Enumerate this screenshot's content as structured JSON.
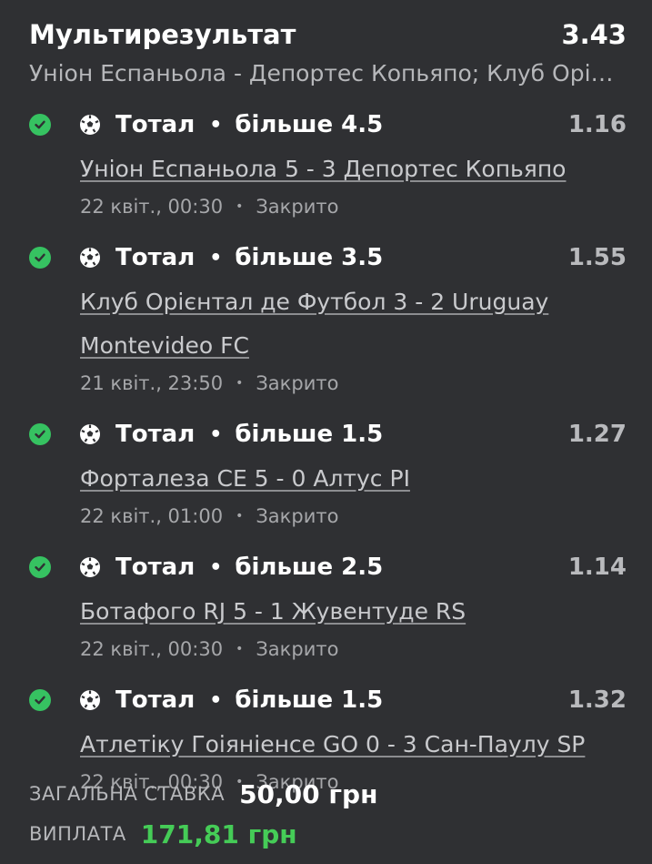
{
  "header": {
    "title": "Мультирезультат",
    "total_odds": "3.43",
    "subtitle": "Уніон Еспаньола - Депортес Копьяпо; Клуб Орієнтал де Футбол - Uruguay Montevideo FC; Форталеза CE - Алтус PI; Ботафого RJ - Жувентуде RS; Атлетіку Гоіяніенсе GO - Сан-Паулу SP"
  },
  "bets": [
    {
      "status_icon": "check-circle-icon",
      "sport_icon": "soccer-ball-icon",
      "market": "Тотал",
      "outcome": "більше 4.5",
      "odds": "1.16",
      "match": "Уніон Еспаньола 5 - 3 Депортес Копьяпо",
      "datetime": "22 квіт., 00:30",
      "state": "Закрито"
    },
    {
      "status_icon": "check-circle-icon",
      "sport_icon": "soccer-ball-icon",
      "market": "Тотал",
      "outcome": "більше 3.5",
      "odds": "1.55",
      "match": "Клуб Орієнтал де Футбол 3 - 2 Uruguay Montevideo FC",
      "datetime": "21 квіт., 23:50",
      "state": "Закрито"
    },
    {
      "status_icon": "check-circle-icon",
      "sport_icon": "soccer-ball-icon",
      "market": "Тотал",
      "outcome": "більше 1.5",
      "odds": "1.27",
      "match": "Форталеза CE 5 - 0 Алтус PI",
      "datetime": "22 квіт., 01:00",
      "state": "Закрито"
    },
    {
      "status_icon": "check-circle-icon",
      "sport_icon": "soccer-ball-icon",
      "market": "Тотал",
      "outcome": "більше 2.5",
      "odds": "1.14",
      "match": "Ботафого RJ 5 - 1 Жувентуде RS",
      "datetime": "22 квіт., 00:30",
      "state": "Закрито"
    },
    {
      "status_icon": "check-circle-icon",
      "sport_icon": "soccer-ball-icon",
      "market": "Тотал",
      "outcome": "більше 1.5",
      "odds": "1.32",
      "match": "Атлетіку Гоіяніенсе GO 0 - 3 Сан-Паулу SP",
      "datetime": "22 квіт., 00:30",
      "state": "Закрито"
    }
  ],
  "summary": {
    "stake_label": "ЗАГАЛЬНА СТАВКА",
    "stake_value": "50,00 грн",
    "payout_label": "ВИПЛАТА",
    "payout_value": "171,81 грн"
  },
  "colors": {
    "background": "#2f3033",
    "win_green": "#36c261",
    "payout_green": "#45cc57"
  }
}
